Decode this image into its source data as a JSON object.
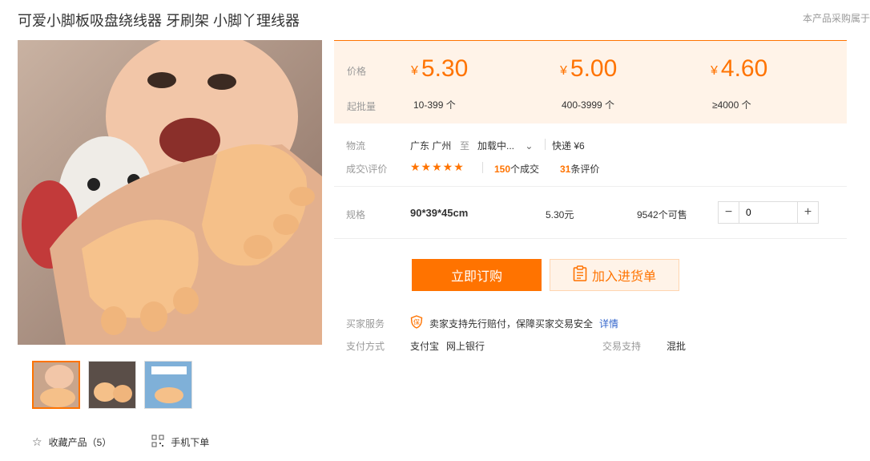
{
  "product": {
    "title": "可爱小脚板吸盘绕线器 牙刷架 小脚丫理线器",
    "header_note": "本产品采购属于"
  },
  "price_box": {
    "price_label": "价格",
    "moq_label": "起批量",
    "tiers": [
      {
        "currency": "¥",
        "price": "5.30",
        "range": "10-399 个"
      },
      {
        "currency": "¥",
        "price": "5.00",
        "range": "400-3999 个"
      },
      {
        "currency": "¥",
        "price": "4.60",
        "range": "≥4000 个"
      }
    ]
  },
  "logistics": {
    "label": "物流",
    "from": "广东 广州",
    "to_word": "至",
    "destination": "加载中...",
    "express": "快递 ¥6"
  },
  "reviews": {
    "label": "成交\\评价",
    "stars": "★★★★★",
    "deals_count": "150",
    "deals_suffix": "个成交",
    "review_count": "31",
    "review_suffix": "条评价"
  },
  "spec": {
    "label": "规格",
    "value": "90*39*45cm",
    "price": "5.30元",
    "stock": "9542个可售",
    "quantity": "0"
  },
  "actions": {
    "buy_label": "立即订购",
    "cart_label": "加入进货单"
  },
  "service": {
    "label": "买家服务",
    "text": "卖家支持先行赔付，保障买家交易安全",
    "detail_link": "详情"
  },
  "payment": {
    "label": "支付方式",
    "methods": [
      "支付宝",
      "网上银行"
    ],
    "trade_label": "交易支持",
    "trade_value": "混批"
  },
  "bottom": {
    "favorite": "收藏产品（5）",
    "mobile": "手机下单"
  },
  "colors": {
    "accent": "#ff7300",
    "price_bg": "#fff3e8",
    "link": "#3366cc"
  }
}
